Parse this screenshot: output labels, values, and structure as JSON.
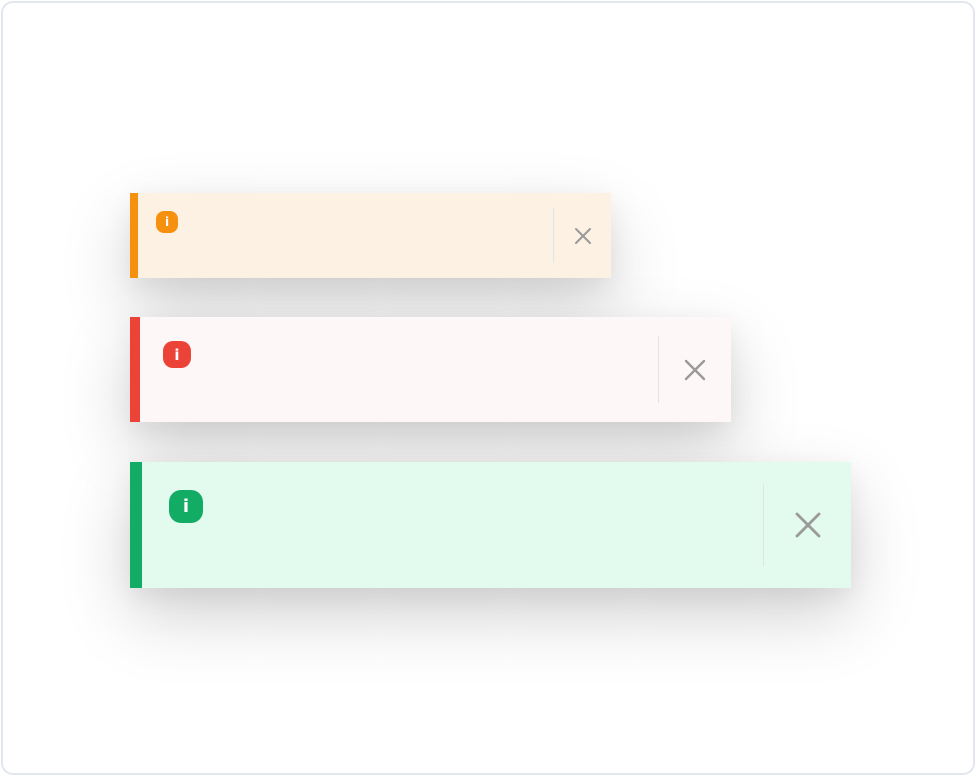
{
  "toasts": [
    {
      "size": "small",
      "variant": "warning",
      "accent_color": "#f6910f",
      "background_color": "#fcf1e2",
      "icon": "info-icon",
      "icon_glyph": "i",
      "close_icon": "close-icon"
    },
    {
      "size": "medium",
      "variant": "error",
      "accent_color": "#eb4337",
      "background_color": "#fef7f7",
      "icon": "info-icon",
      "icon_glyph": "i",
      "close_icon": "close-icon"
    },
    {
      "size": "large",
      "variant": "success",
      "accent_color": "#13ac64",
      "background_color": "#e3faee",
      "icon": "info-icon",
      "icon_glyph": "i",
      "close_icon": "close-icon"
    }
  ]
}
